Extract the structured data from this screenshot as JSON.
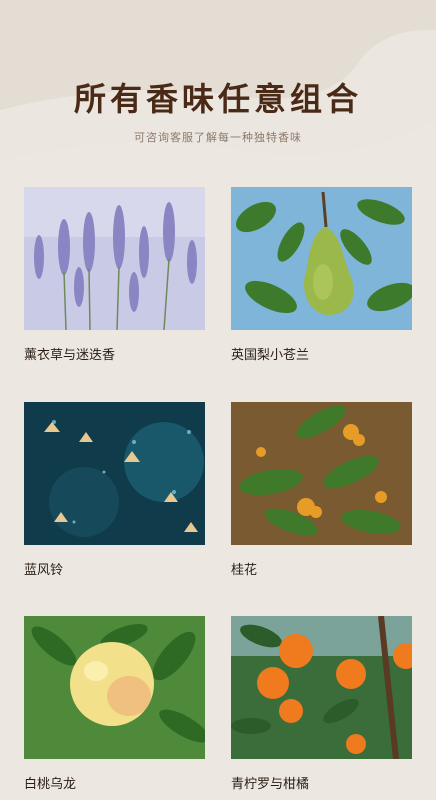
{
  "header": {
    "title": "所有香味任意组合",
    "subtitle": "可咨询客服了解每一种独特香味"
  },
  "scents": [
    {
      "label": "薰衣草与迷迭香",
      "image": "lavender-photo"
    },
    {
      "label": "英国梨小苍兰",
      "image": "pear-photo"
    },
    {
      "label": "蓝风铃",
      "image": "bluebell-photo"
    },
    {
      "label": "桂花",
      "image": "osmanthus-photo"
    },
    {
      "label": "白桃乌龙",
      "image": "white-peach-photo"
    },
    {
      "label": "青柠罗与柑橘",
      "image": "orange-photo"
    }
  ]
}
